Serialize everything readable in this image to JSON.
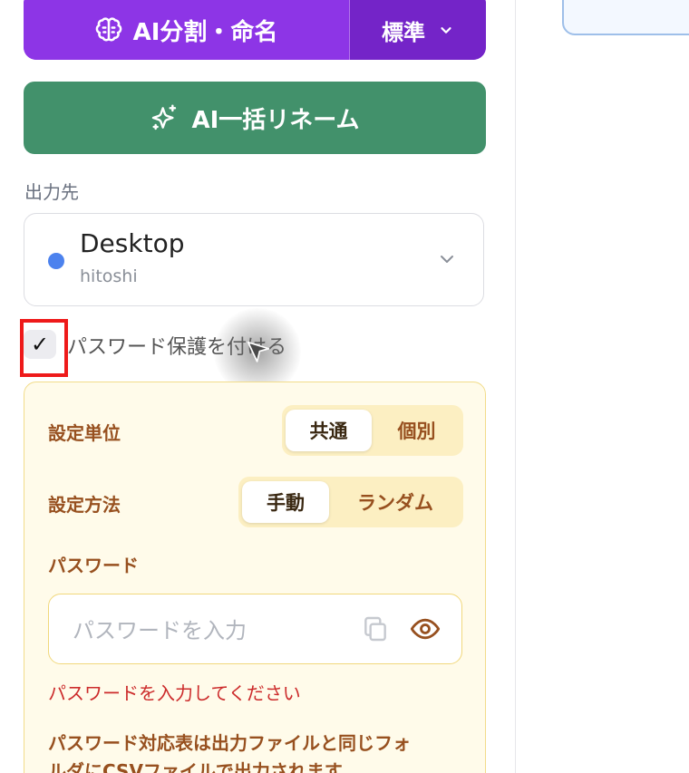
{
  "split_button": {
    "label": "AI分割・命名",
    "mode": "標準",
    "colors": {
      "main": "#8d35e6",
      "mode": "#7424c8"
    },
    "icons": {
      "main": "brain-icon",
      "mode": "chevron-down-icon"
    }
  },
  "rename_button": {
    "label": "AI一括リネーム",
    "icon": "sparkles-icon",
    "color": "#42916b"
  },
  "output": {
    "label": "出力先",
    "destination_name": "Desktop",
    "destination_sub": "hitoshi",
    "dot_color": "#4c82ee"
  },
  "password_protect": {
    "checked": true,
    "check_glyph": "✓",
    "label": "パスワード保護を付ける"
  },
  "password_panel": {
    "unit": {
      "label": "設定単位",
      "options": [
        "共通",
        "個別"
      ],
      "selected": "共通"
    },
    "method": {
      "label": "設定方法",
      "options": [
        "手動",
        "ランダム"
      ],
      "selected": "手動"
    },
    "password_label": "パスワード",
    "placeholder": "パスワードを入力",
    "error": "パスワードを入力してください",
    "note_line1": "パスワード対応表は出力ファイルと同じフォ",
    "note_line2": "ルダにCSVファイルで出力されます。"
  }
}
